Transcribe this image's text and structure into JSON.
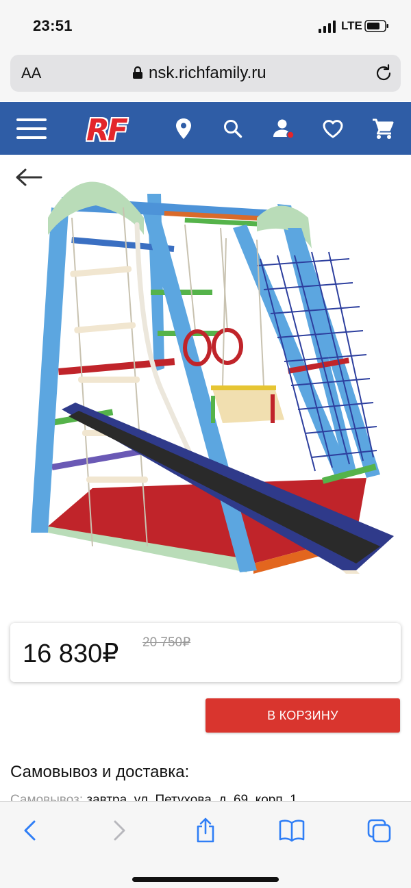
{
  "status_bar": {
    "time": "23:51",
    "network": "LTE"
  },
  "browser": {
    "text_size_label": "AA",
    "url": "nsk.richfamily.ru",
    "icons": [
      "lock-icon",
      "reload-icon"
    ]
  },
  "site_header": {
    "logo": "RF",
    "background_color": "#2f5da6",
    "icons": [
      "menu-icon",
      "location-icon",
      "search-icon",
      "user-icon",
      "heart-icon",
      "cart-icon"
    ]
  },
  "product": {
    "image_alt": "sports-complex-product-photo",
    "price": "16 830₽",
    "old_price": "20 750₽",
    "add_to_cart_label": "В КОРЗИНУ",
    "cart_button_color": "#d9352e"
  },
  "delivery": {
    "title": "Самовывоз и доставка:",
    "pickup_label": "Самовывоз:",
    "pickup_text": " завтра, ул. Петухова, д. 69, корп. 1"
  },
  "toolbar": {
    "icons": [
      "back-icon",
      "forward-icon",
      "share-icon",
      "bookmarks-icon",
      "tabs-icon"
    ]
  }
}
